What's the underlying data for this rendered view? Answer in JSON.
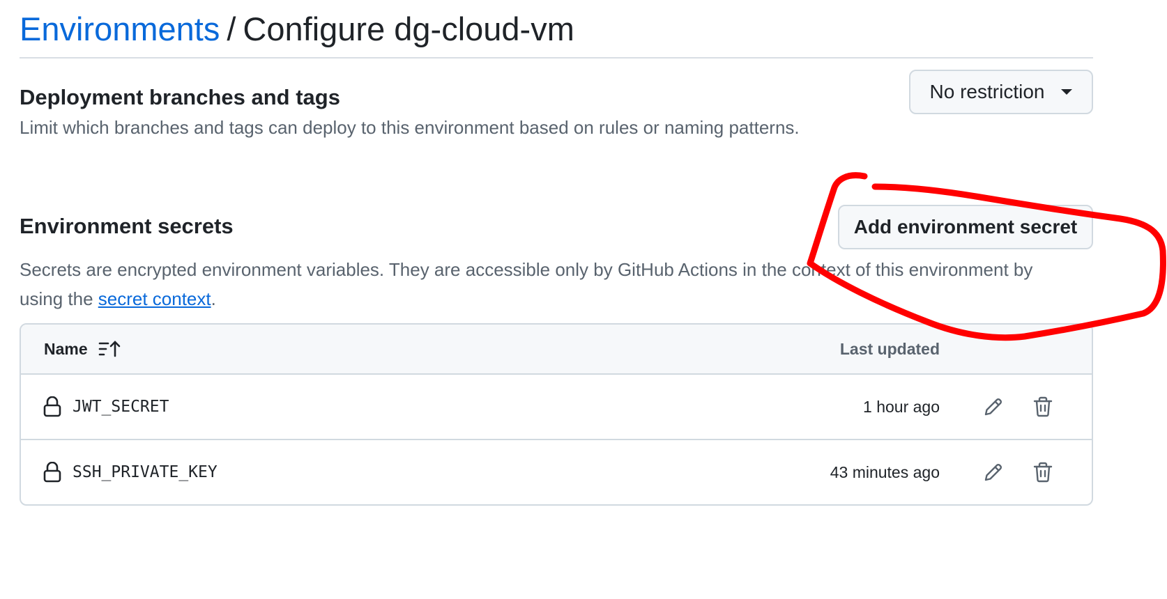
{
  "breadcrumb": {
    "parent": "Environments",
    "separator": "/",
    "current": "Configure dg-cloud-vm"
  },
  "deployment": {
    "title": "Deployment branches and tags",
    "description": "Limit which branches and tags can deploy to this environment based on rules or naming patterns.",
    "dropdown_value": "No restriction",
    "dropdown_icon": "triangle-down-icon"
  },
  "secrets": {
    "title": "Environment secrets",
    "add_button_label": "Add environment secret",
    "description_before": "Secrets are encrypted environment variables. They are accessible only by GitHub Actions in the context of this environment by using the ",
    "description_link": "secret context",
    "description_after": ".",
    "table": {
      "columns": {
        "name": "Name",
        "last_updated": "Last updated"
      },
      "sort_icon": "sort-asc-icon",
      "rows": [
        {
          "name": "JWT_SECRET",
          "updated": "1 hour ago",
          "icon": "lock-icon"
        },
        {
          "name": "SSH_PRIVATE_KEY",
          "updated": "43 minutes ago",
          "icon": "lock-icon"
        }
      ]
    }
  },
  "colors": {
    "link": "#0969da",
    "text": "#1f2328",
    "muted": "#59636e",
    "border": "#d1d9e0",
    "annotation": "#ff0000"
  }
}
